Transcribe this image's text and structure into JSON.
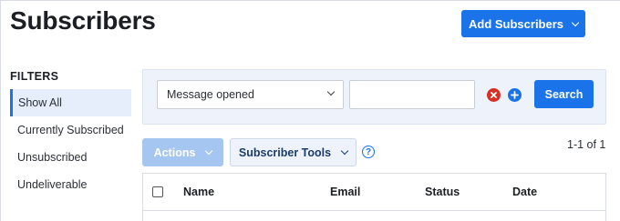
{
  "header": {
    "title": "Subscribers",
    "add_button_label": "Add Subscribers"
  },
  "filters": {
    "heading": "FILTERS",
    "items": [
      {
        "label": "Show All",
        "active": true
      },
      {
        "label": "Currently Subscribed",
        "active": false
      },
      {
        "label": "Unsubscribed",
        "active": false
      },
      {
        "label": "Undeliverable",
        "active": false
      }
    ]
  },
  "search": {
    "condition_selected": "Message opened",
    "value": "",
    "remove_icon": "close-circle-icon",
    "add_icon": "plus-circle-icon",
    "button_label": "Search"
  },
  "toolbar": {
    "actions_label": "Actions",
    "tools_label": "Subscriber Tools",
    "help_icon": "question-circle-icon",
    "pagination": "1-1 of 1"
  },
  "table": {
    "columns": [
      "Name",
      "Email",
      "Status",
      "Date"
    ]
  },
  "colors": {
    "accent": "#1a73e8",
    "danger": "#d93025",
    "panel": "#eef3fb",
    "actions_disabled": "#a6c6f2"
  }
}
